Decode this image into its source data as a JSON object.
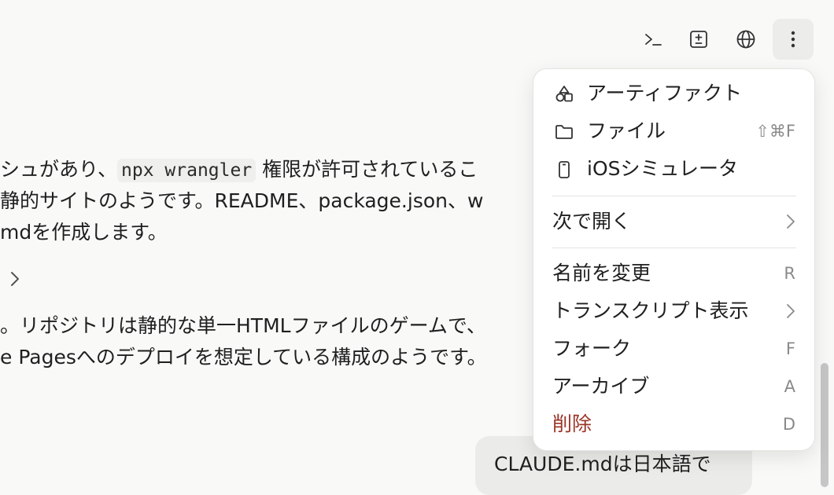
{
  "toolbar": {
    "buttons": [
      {
        "name": "terminal-icon"
      },
      {
        "name": "diff-icon"
      },
      {
        "name": "globe-icon"
      },
      {
        "name": "more-vertical-icon"
      }
    ]
  },
  "content": {
    "line1_pre": "シュがあり、",
    "line1_code": "npx wrangler",
    "line1_post": " 権限が許可されているこ",
    "line2": "静的サイトのようです。README、package.json、w",
    "line3": "mdを作成します。",
    "line4": "。リポジトリは静的な単一HTMLファイルのゲームで、",
    "line5": "e Pagesへのデプロイを想定している構成のようです。"
  },
  "user_message": "CLAUDE.mdは日本語で",
  "menu": {
    "artifact": "アーティファクト",
    "files": "ファイル",
    "files_shortcut": "⇧⌘F",
    "ios_sim": "iOSシミュレータ",
    "open_in": "次で開く",
    "rename": "名前を変更",
    "rename_shortcut": "R",
    "transcript": "トランスクリプト表示",
    "fork": "フォーク",
    "fork_shortcut": "F",
    "archive": "アーカイブ",
    "archive_shortcut": "A",
    "delete": "削除",
    "delete_shortcut": "D"
  },
  "colors": {
    "background": "#f9f9f8",
    "menu_bg": "#ffffff",
    "danger": "#9a3427",
    "bubble": "#ebebe9"
  }
}
